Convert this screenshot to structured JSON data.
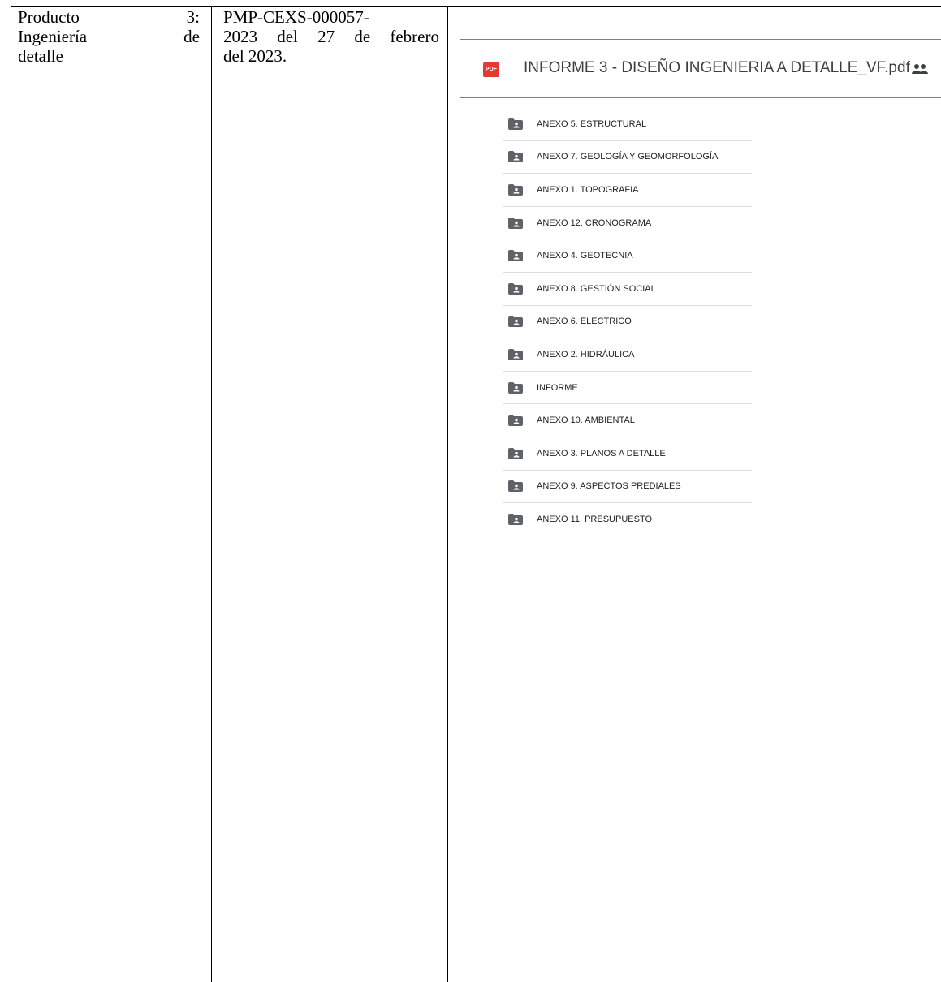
{
  "table": {
    "col1": {
      "line1_left": "Producto",
      "line1_right": "3:",
      "line2_left": "Ingeniería",
      "line2_right": "de",
      "line3": "detalle"
    },
    "col2": {
      "line1": "PMP-CEXS-000057-",
      "line2_left": "2023",
      "line2_words": [
        "del",
        "27",
        "de",
        "febrero"
      ],
      "line3": "del 2023."
    }
  },
  "drive": {
    "pdf_badge": "PDF",
    "file_name": "INFORME 3 - DISEÑO INGENIERIA A DETALLE_VF.pdf",
    "file_icon": "pdf-icon",
    "shared_icon": "people-icon",
    "folder_icon": "shared-folder-icon",
    "folders": [
      "ANEXO 5. ESTRUCTURAL",
      "ANEXO 7. GEOLOGÍA Y GEOMORFOLOGÍA",
      "ANEXO 1. TOPOGRAFIA",
      "ANEXO 12. CRONOGRAMA",
      "ANEXO 4. GEOTECNIA",
      "ANEXO 8. GESTIÓN SOCIAL",
      "ANEXO 6. ELECTRICO",
      "ANEXO 2. HIDRÁULICA",
      "INFORME",
      "ANEXO 10. AMBIENTAL",
      "ANEXO 3. PLANOS A DETALLE",
      "ANEXO 9. ASPECTOS PREDIALES",
      "ANEXO 11. PRESUPUESTO"
    ]
  }
}
